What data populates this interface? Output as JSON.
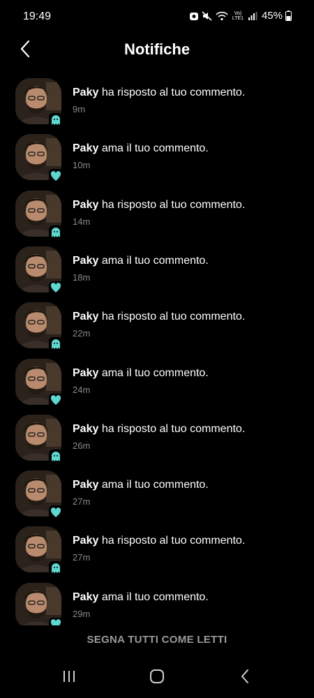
{
  "status_bar": {
    "time": "19:49",
    "network_label": "Vo) LTE1",
    "battery_pct": "45%"
  },
  "header": {
    "title": "Notifiche",
    "back_icon": "chevron-left-icon"
  },
  "notifications": [
    {
      "user": "Paky",
      "action": " ha risposto al tuo commento.",
      "time": "9m",
      "badge": "ghost-icon"
    },
    {
      "user": "Paky",
      "action": " ama il tuo commento.",
      "time": "10m",
      "badge": "heart-icon"
    },
    {
      "user": "Paky",
      "action": " ha risposto al tuo commento.",
      "time": "14m",
      "badge": "ghost-icon"
    },
    {
      "user": "Paky",
      "action": " ama il tuo commento.",
      "time": "18m",
      "badge": "heart-icon"
    },
    {
      "user": "Paky",
      "action": " ha risposto al tuo commento.",
      "time": "22m",
      "badge": "ghost-icon"
    },
    {
      "user": "Paky",
      "action": " ama il tuo commento.",
      "time": "24m",
      "badge": "heart-icon"
    },
    {
      "user": "Paky",
      "action": " ha risposto al tuo commento.",
      "time": "26m",
      "badge": "ghost-icon"
    },
    {
      "user": "Paky",
      "action": " ama il tuo commento.",
      "time": "27m",
      "badge": "heart-icon"
    },
    {
      "user": "Paky",
      "action": " ha risposto al tuo commento.",
      "time": "27m",
      "badge": "ghost-icon"
    },
    {
      "user": "Paky",
      "action": " ama il tuo commento.",
      "time": "29m",
      "badge": "heart-icon"
    }
  ],
  "footer": {
    "mark_all_label": "SEGNA TUTTI COME LETTI"
  },
  "colors": {
    "background": "#000000",
    "accent_badge": "#5fd6d0",
    "secondary_text": "#8a8a8a"
  }
}
